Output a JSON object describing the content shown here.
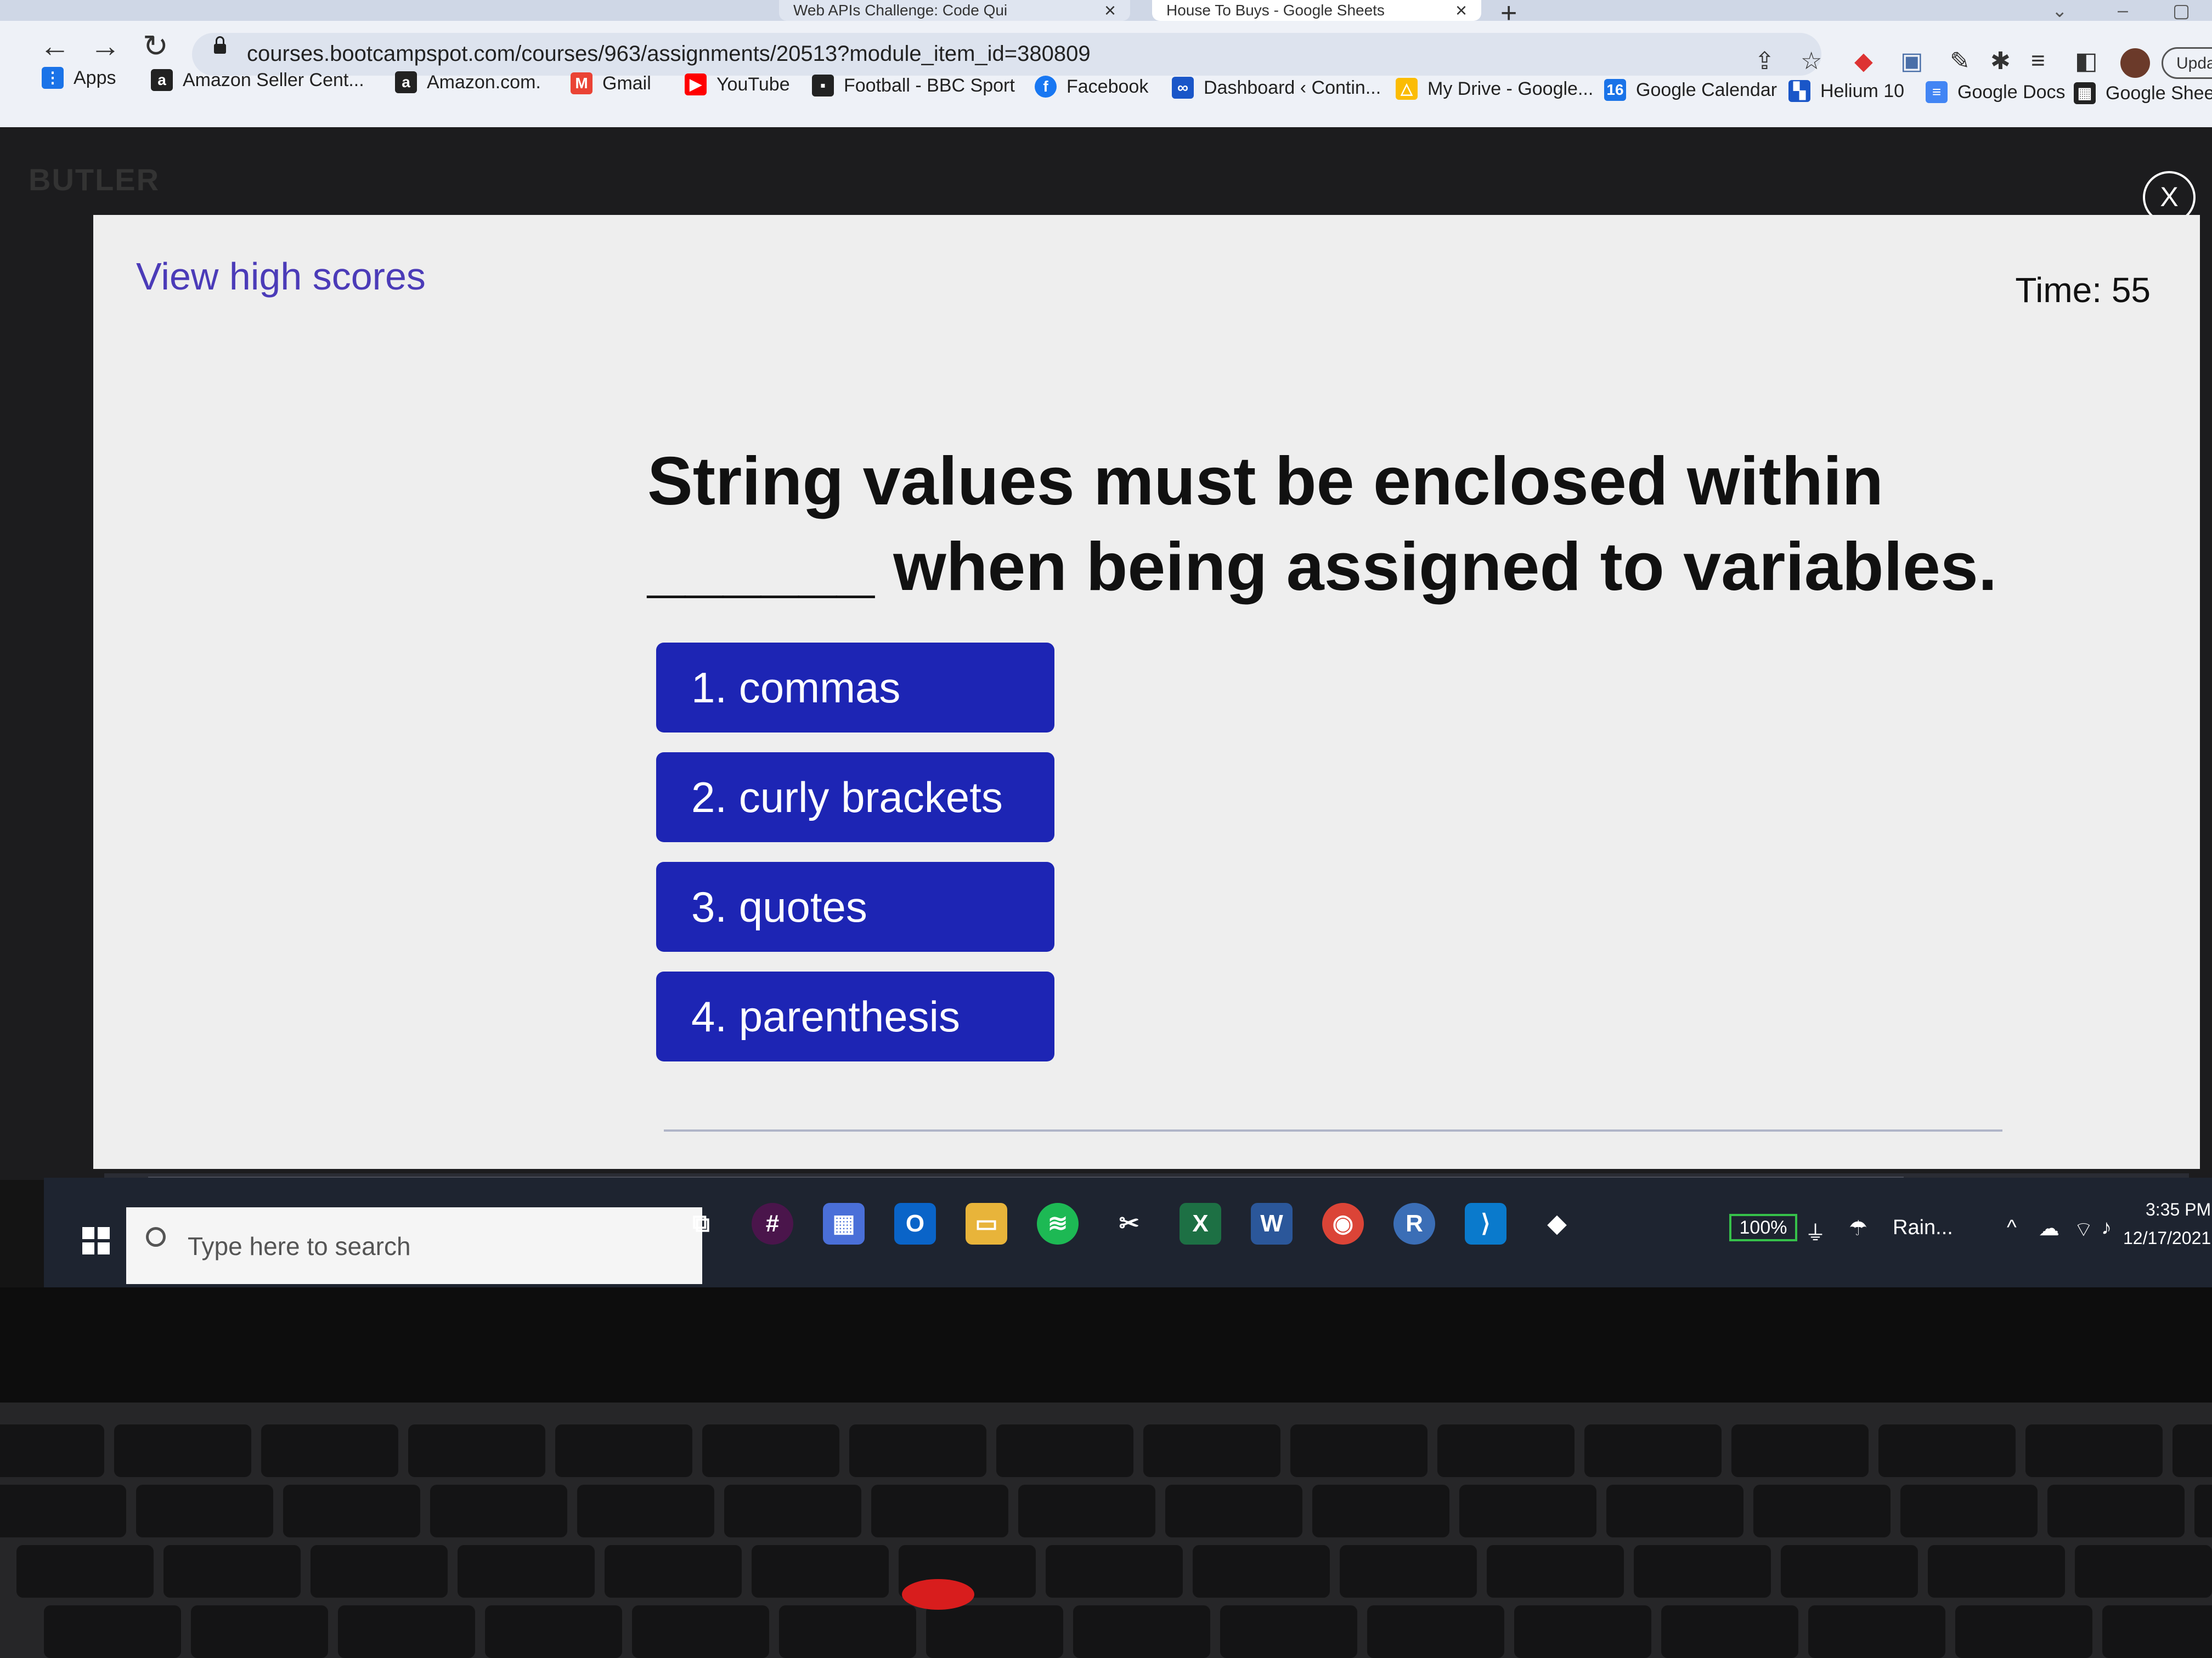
{
  "browser": {
    "tabs": [
      {
        "label": "Web APIs Challenge: Code Qui"
      },
      {
        "label": "House To Buys - Google Sheets"
      }
    ],
    "url": "courses.bootcampspot.com/courses/963/assignments/20513?module_item_id=380809",
    "update_label": "Upda",
    "bookmarks": [
      {
        "label": "Apps",
        "icon": "apps-grid-icon",
        "color": "#1a73e8"
      },
      {
        "label": "Amazon Seller Cent...",
        "icon": "amazon-icon",
        "color": "#222222"
      },
      {
        "label": "Amazon.com.",
        "icon": "amazon-icon",
        "color": "#222222"
      },
      {
        "label": "Gmail",
        "icon": "gmail-icon",
        "color": "#ea4335"
      },
      {
        "label": "YouTube",
        "icon": "youtube-icon",
        "color": "#ff0000"
      },
      {
        "label": "Football - BBC Sport",
        "icon": "bbc-icon",
        "color": "#222222"
      },
      {
        "label": "Facebook",
        "icon": "facebook-icon",
        "color": "#1877f2"
      },
      {
        "label": "Dashboard ‹ Contin...",
        "icon": "dashboard-icon",
        "color": "#1a56c8"
      },
      {
        "label": "My Drive - Google...",
        "icon": "drive-icon",
        "color": "#fbbc04"
      },
      {
        "label": "Google Calendar",
        "icon": "calendar-icon",
        "color": "#1a73e8"
      },
      {
        "label": "Helium 10",
        "icon": "helium-icon",
        "color": "#1a56c8"
      },
      {
        "label": "Google Docs",
        "icon": "docs-icon",
        "color": "#4285f4"
      },
      {
        "label": "Google Sheets",
        "icon": "sheets-icon",
        "color": "#222222"
      }
    ]
  },
  "page": {
    "brand": "BUTLER"
  },
  "quiz": {
    "high_scores_label": "View high scores",
    "timer": "Time: 55",
    "question": "String values must be enclosed within ______ when being assigned to variables.",
    "choices": [
      {
        "label": "1.  commas"
      },
      {
        "label": "2. curly brackets"
      },
      {
        "label": "3. quotes"
      },
      {
        "label": "4. parenthesis"
      }
    ],
    "accent_color": "#1d25b4",
    "link_color": "#4b3bb8"
  },
  "modal": {
    "close_label": "X"
  },
  "taskbar": {
    "search_placeholder": "Type here to search",
    "battery": "100%",
    "weather": "Rain...",
    "time": "3:35 PM",
    "date": "12/17/2021"
  }
}
